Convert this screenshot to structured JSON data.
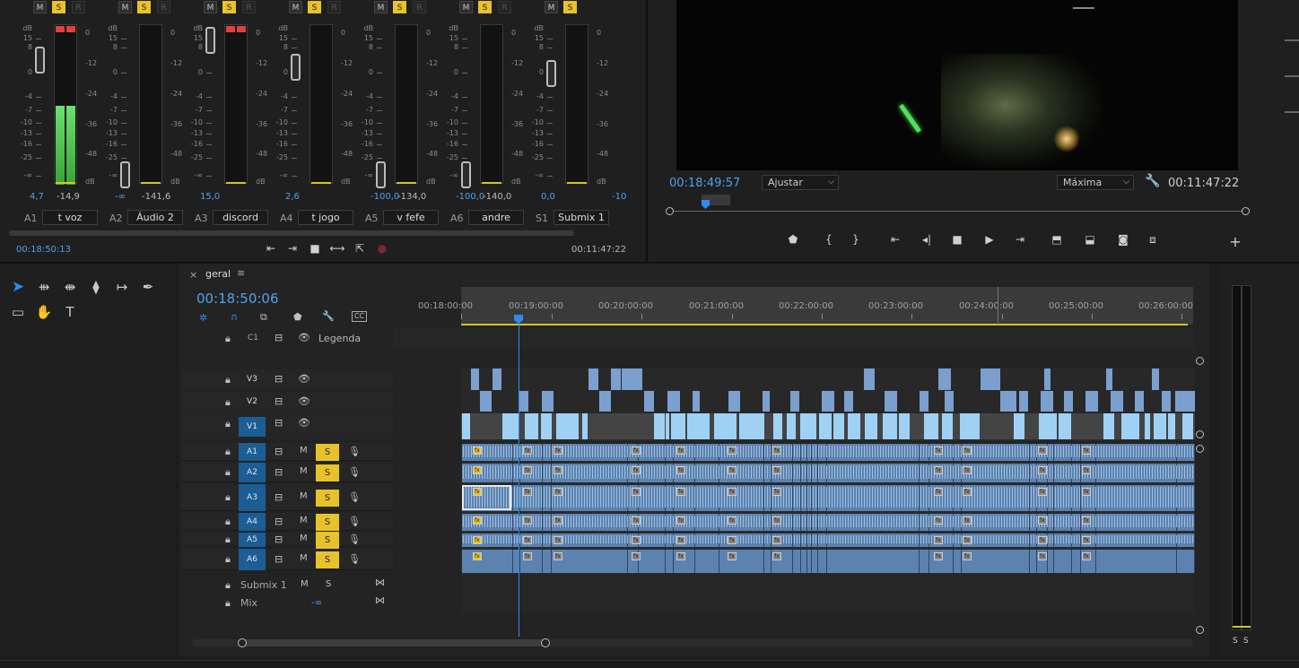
{
  "mixer": {
    "channels": [
      {
        "id": "A1",
        "name": "t voz",
        "value": "4,7",
        "peak": "-14,9"
      },
      {
        "id": "A2",
        "name": "Áudio 2",
        "value": "-∞",
        "peak": "-141,6"
      },
      {
        "id": "A3",
        "name": "discord",
        "value": "15,0",
        "peak": ""
      },
      {
        "id": "A4",
        "name": "t jogo",
        "value": "2,6",
        "peak": ""
      },
      {
        "id": "A5",
        "name": "v fefe",
        "value": "-100,0",
        "peak": "-134,0"
      },
      {
        "id": "A6",
        "name": "andre",
        "value": "-100,0",
        "peak": "-140,0"
      },
      {
        "id": "S1",
        "name": "Submix 1",
        "value": "0,0",
        "peak": ""
      }
    ],
    "last_value": "-10",
    "db_left": [
      "dB",
      "15",
      "8",
      "0",
      "-4",
      "-7",
      "-10",
      "-13",
      "-16",
      "-25",
      "-∞"
    ],
    "db_right": [
      "0",
      "-12",
      "-24",
      "-36",
      "-48",
      "dB"
    ],
    "db_right_short": [
      "0",
      "-12",
      "-24",
      "-36",
      "-48",
      "dB"
    ],
    "m_label": "M",
    "s_label": "S",
    "r_label": "R",
    "timecode_left": "00:18:50:13",
    "timecode_right": "00:11:47:22",
    "transport": [
      "⇤",
      "⇥",
      "■",
      "⟷",
      "⇱",
      "●"
    ]
  },
  "program": {
    "timecode": "00:18:49:57",
    "fit": "Ajustar",
    "quality": "Máxima",
    "duration": "00:11:47:22",
    "controls": [
      "marker",
      "mark-in",
      "mark-out",
      "go-to-in",
      "step-back",
      "stop",
      "play",
      "go-to-out",
      "lift",
      "extract",
      "export-frame",
      "compare",
      "add"
    ]
  },
  "timeline": {
    "sequence_name": "geral",
    "close_label": "×",
    "menu_label": "≡",
    "timecode": "00:18:50:06",
    "ruler": [
      "00:18:00:00",
      "00:19:00:00",
      "00:20:00:00",
      "00:21:00:00",
      "00:22:00:00",
      "00:23:00:00",
      "00:24:00:00",
      "00:25:00:00",
      "00:26:00:00"
    ],
    "caption_track": {
      "id": "C1",
      "name": "Legenda"
    },
    "video_tracks": [
      "V3",
      "V2",
      "V1"
    ],
    "audio_tracks": [
      "A1",
      "A2",
      "A3",
      "A4",
      "A5",
      "A6"
    ],
    "submix": {
      "name": "Submix 1",
      "m": "M",
      "s": "S"
    },
    "mix": {
      "name": "Mix",
      "value": "-∞"
    },
    "playhead_fraction_of_view": 0.078
  },
  "meter_right": {
    "s1": "S",
    "s2": "S"
  },
  "colors": {
    "accent": "#2d8ceb",
    "solo": "#e8c22a",
    "video_clip": "#7b9fcf",
    "v1_clip": "#9fd1f5",
    "audio_clip": "#5c82b0",
    "track_active": "#1b5d94"
  }
}
